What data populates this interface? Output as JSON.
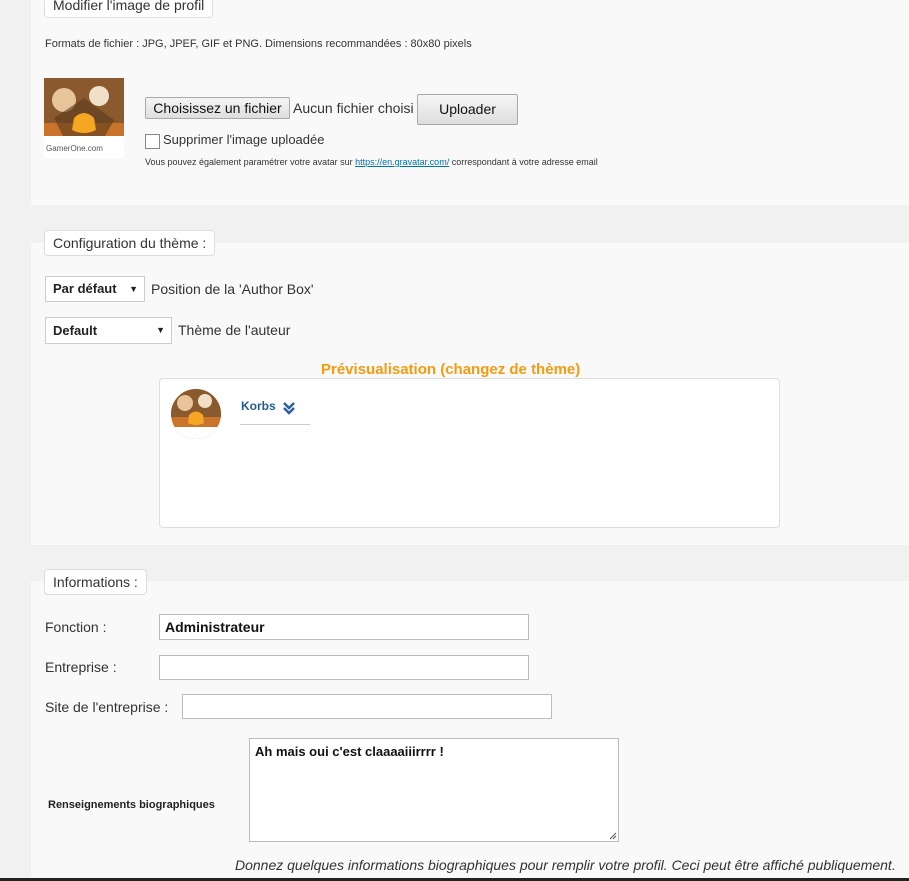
{
  "profile_image": {
    "legend": "Modifier l'image de profil",
    "formats_text": "Formats de fichier : JPG, JPEF, GIF et PNG. Dimensions recommandées : 80x80 pixels",
    "avatar_logo_text": "GamerOne.com",
    "choose_file_label": "Choisissez un fichier",
    "no_file_text": "Aucun fichier choisi",
    "upload_label": "Uploader",
    "delete_checkbox_label": "Supprimer l'image uploadée",
    "gravatar_prefix": "Vous pouvez également paramétrer votre avatar sur",
    "gravatar_link": "https://en.gravatar.com/",
    "gravatar_suffix": "correspondant à votre adresse email"
  },
  "theme_config": {
    "legend": "Configuration du thème :",
    "position_select_value": "Par défaut",
    "position_label": "Position de la 'Author Box'",
    "theme_select_value": "Default",
    "theme_label": "Thème de l'auteur",
    "preview_title": "Prévisualisation (changez de thème)",
    "preview_author_name": "Korbs",
    "accent_color": "#f39c12"
  },
  "informations": {
    "legend": "Informations :",
    "fonction_label": "Fonction :",
    "fonction_value": "Administrateur",
    "entreprise_label": "Entreprise :",
    "entreprise_value": "",
    "site_label": "Site de l'entreprise :",
    "site_value": "",
    "bio_label": "Renseignements biographiques",
    "bio_value": "Ah mais oui c'est claaaaiiirrrr !",
    "bio_help": "Donnez quelques informations biographiques pour remplir votre profil. Ceci peut être affiché publiquement."
  }
}
